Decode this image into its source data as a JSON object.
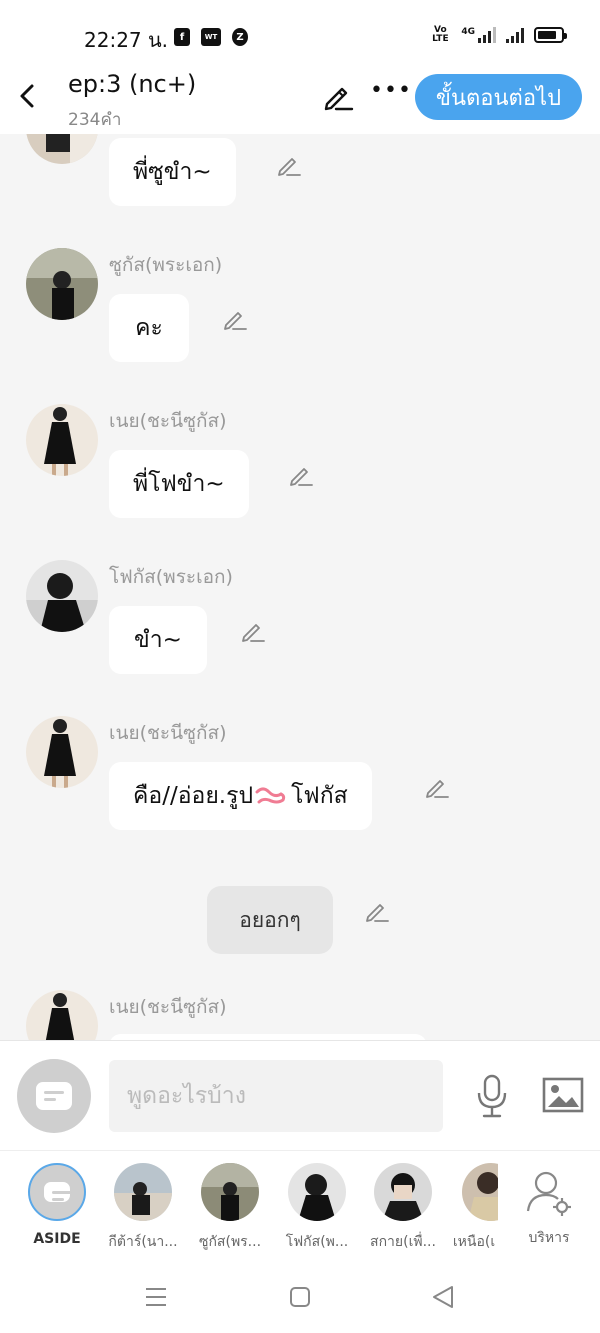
{
  "status_bar": {
    "time": "22:27 น.",
    "app_icons": [
      "facebook-icon",
      "webtoon-icon",
      "z-app-icon"
    ],
    "volte": "Vo\nLTE",
    "network": "4G"
  },
  "header": {
    "title": "ep:3 (nc+)",
    "word_count": "234คำ",
    "next_label": "ขั้นตอนต่อไป",
    "more_label": "•••"
  },
  "messages": [
    {
      "sender": "",
      "text": "พี่ซูขำ~"
    },
    {
      "sender": "ซูกัส(พระเอก)",
      "text": "คะ"
    },
    {
      "sender": "เนย(ชะนีซูกัส)",
      "text": "พี่โฟขำ~"
    },
    {
      "sender": "โฟกัส(พระเอก)",
      "text": "ขำ~"
    },
    {
      "sender": "เนย(ชะนีซูกัส)",
      "text_before": "คือ//อ่อย.รูป",
      "text_after": "โฟกัส"
    },
    {
      "aside_text": "อยอกๆ"
    },
    {
      "sender": "เนย(ชะนีซูกัส)",
      "text": ""
    }
  ],
  "input": {
    "placeholder": "พูดอะไรบ้าง"
  },
  "characters": [
    {
      "label": "ASIDE"
    },
    {
      "label": "กีต้าร์(นา..."
    },
    {
      "label": "ซูกัส(พร..."
    },
    {
      "label": "โฟกัส(พ..."
    },
    {
      "label": "สกาย(เพื่..."
    },
    {
      "label": "เหนือ(เ"
    },
    {
      "label": "บริหาร"
    }
  ],
  "colors": {
    "accent": "#4aa4ee",
    "bubble": "#ffffff",
    "background": "#f5f5f5"
  }
}
